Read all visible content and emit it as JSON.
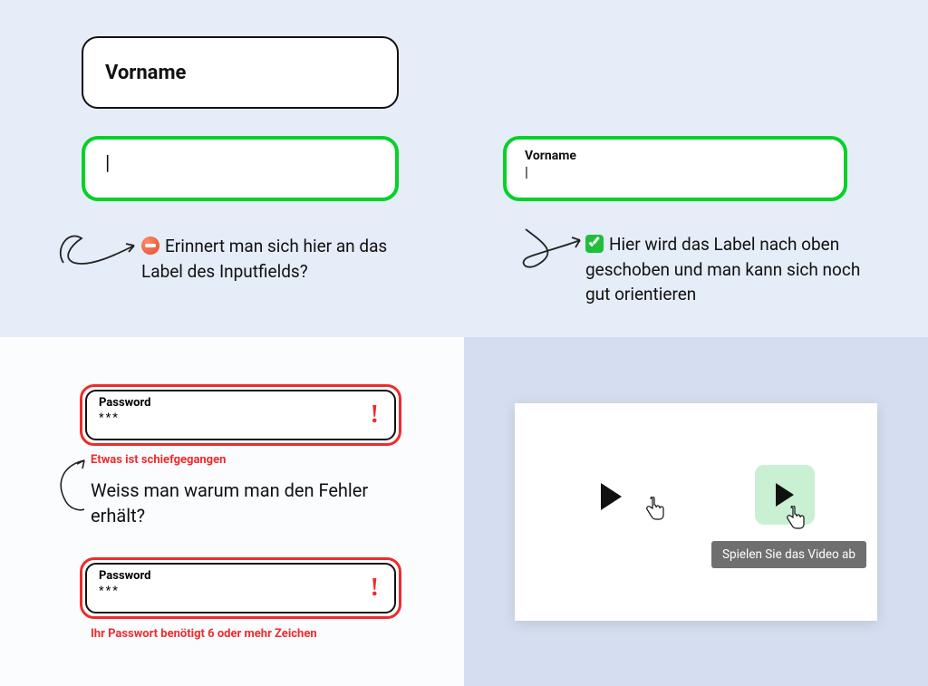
{
  "top_left": {
    "label_box": "Vorname",
    "input_cursor": "|",
    "note": "Erinnert man sich hier an das Label des Inputfields?"
  },
  "top_right": {
    "float_label": "Vorname",
    "input_cursor": "|",
    "note": "Hier wird das Label nach oben geschoben und man kann sich noch gut orientieren"
  },
  "bottom_left": {
    "field1_label": "Password",
    "field1_value": "***",
    "error1": "Etwas ist schiefgegangen",
    "question": "Weiss man warum man den Fehler erhält?",
    "field2_label": "Password",
    "field2_value": "***",
    "error2": "Ihr Passwort benötigt 6 oder mehr Zeichen",
    "bang": "!"
  },
  "bottom_right": {
    "tooltip": "Spielen Sie das Video ab"
  }
}
